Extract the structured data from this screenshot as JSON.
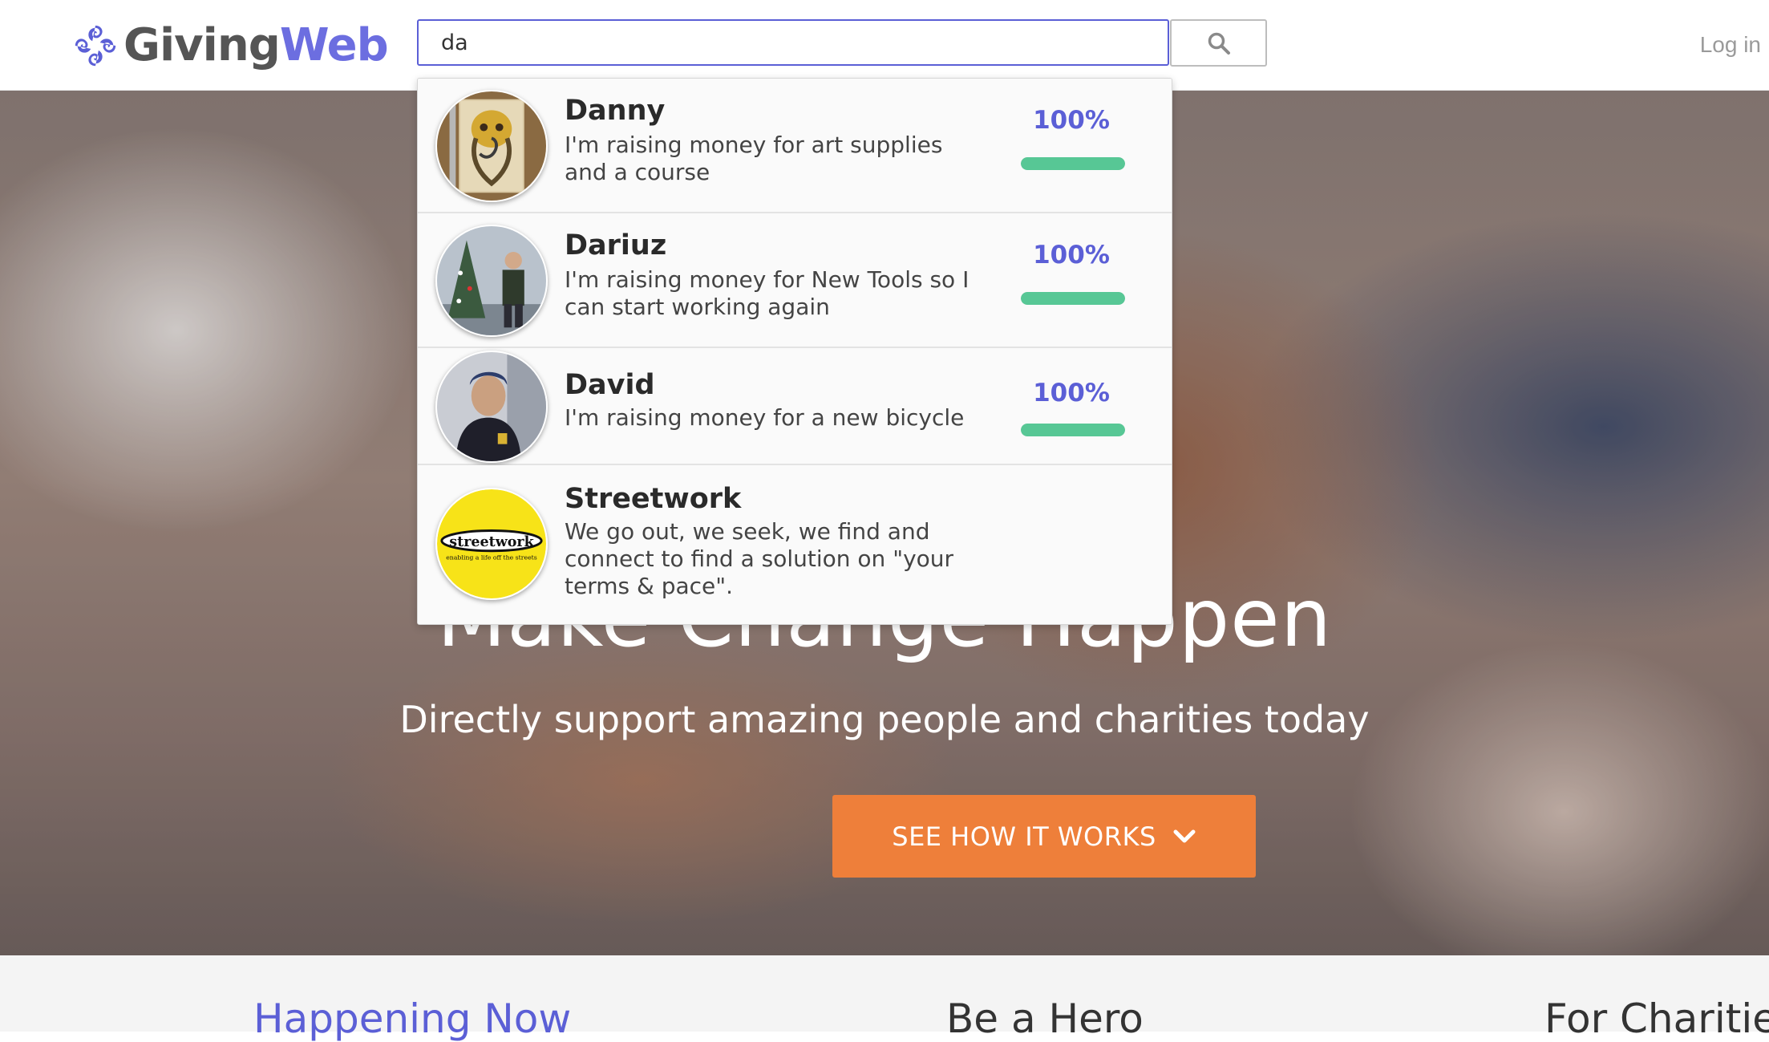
{
  "header": {
    "logo_part1": "Giving",
    "logo_part2": "Web",
    "search_value": "da",
    "login_label": "Log in"
  },
  "search_results": [
    {
      "name": "Danny",
      "description": "I'm raising money for art supplies and a course",
      "percent_label": "100%",
      "progress": 1.0
    },
    {
      "name": "Dariuz",
      "description": "I'm raising money for New Tools so I can start working again",
      "percent_label": "100%",
      "progress": 1.0
    },
    {
      "name": "David",
      "description": "I'm raising money for a new bicycle",
      "percent_label": "100%",
      "progress": 1.0
    },
    {
      "name": "Streetwork",
      "description": "We go out, we seek, we find and connect to find a solution on \"your terms & pace\".",
      "logo_text": "streetwork",
      "logo_tagline": "enabling a life off the streets"
    }
  ],
  "hero": {
    "title": "Make Change Happen",
    "subtitle": "Directly support amazing people and charities today",
    "cta_label": "SEE HOW IT WORKS"
  },
  "sections": [
    {
      "label": "Happening Now",
      "color": "#5b5fd6"
    },
    {
      "label": "Be a Hero",
      "color": "#333333"
    },
    {
      "label": "For Charities",
      "color": "#333333"
    }
  ],
  "colors": {
    "accent": "#5b5fd6",
    "cta": "#ee7f3a",
    "progress": "#57c795"
  },
  "icons": {
    "search": "search-icon",
    "chevron": "chevron-down-icon",
    "logo": "givingweb-logo-icon"
  }
}
